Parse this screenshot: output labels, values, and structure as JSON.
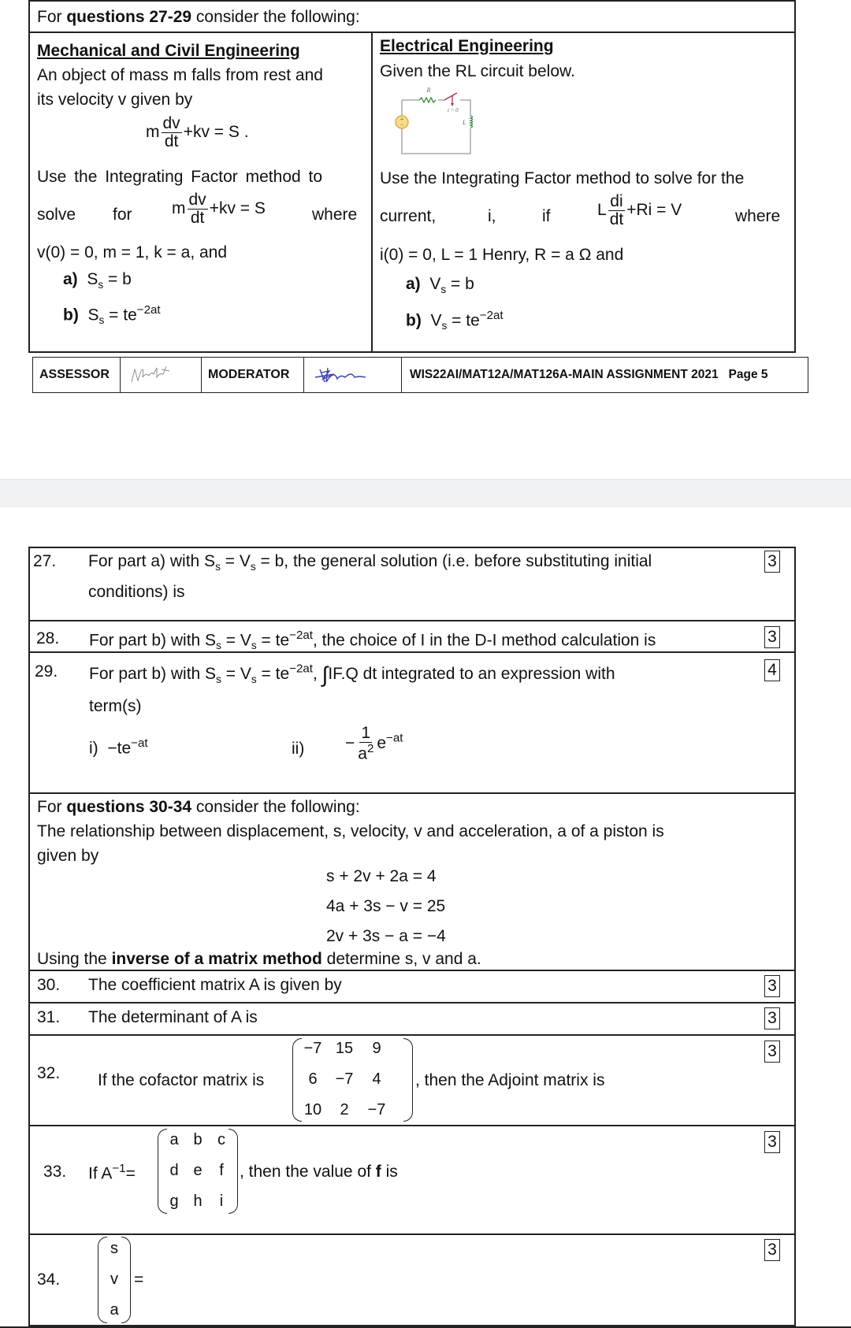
{
  "page1": {
    "intro": {
      "prefix": "For ",
      "bold": "questions 27-29",
      "suffix": " consider the following:"
    },
    "mech": {
      "heading": "Mechanical and Civil Engineering",
      "line1": "An object of mass m falls from rest and",
      "line2": "its velocity v given by",
      "eq_m": "m",
      "eq_num": "dv",
      "eq_den": "dt",
      "eq_rest": "+kv = S .",
      "use_line": "Use the Integrating Factor method to",
      "solve_word": "solve",
      "for_word": "for",
      "eq2_rest": "+kv = S",
      "where_word": "where",
      "conds": "v(0) = 0, m = 1, k = a,  and",
      "a_label": "a)",
      "a_S": "S",
      "a_sub": "s",
      "a_rest": " = b",
      "b_label": "b)",
      "b_S": "S",
      "b_sub": "s",
      "b_rest": " = te",
      "b_sup": "−2at"
    },
    "elec": {
      "heading": "Electrical Engineering",
      "line1": "Given the RL circuit below.",
      "circuit": {
        "R": "R",
        "L": "L",
        "Vs": "V",
        "Vs_sub": "s",
        "switch": "t = 0"
      },
      "use_line": "Use the Integrating Factor method to solve for the",
      "current_word": "current,",
      "i_word": "i,",
      "if_word": "if",
      "eq_L": "L",
      "eq_num": "di",
      "eq_den": "dt",
      "eq_rest": "+Ri = V",
      "where_word": "where",
      "conds": "i(0) = 0, L = 1 Henry,  R = a Ω   and",
      "a_label": "a)",
      "a_V": "V",
      "a_sub": "s",
      "a_rest": " = b",
      "b_label": "b)",
      "b_V": "V",
      "b_sub": "s",
      "b_rest": " = te",
      "b_sup": "−2at"
    },
    "footer": {
      "assessor": "ASSESSOR",
      "moderator": "MODERATOR",
      "code": "WIS22AI/MAT12A/MAT126A-MAIN ASSIGNMENT 2021",
      "page": "Page 5"
    }
  },
  "page2": {
    "q27": {
      "num": "27.",
      "t1": "For part a) with S",
      "s1": "s",
      "t2": " = V",
      "s2": "s",
      "t3": " = b, the general solution (i.e. before substituting initial",
      "t4": "conditions) is",
      "marks": "3"
    },
    "q28": {
      "num": "28.",
      "t1": "For part b) with S",
      "s1": "s",
      "t2": " = V",
      "s2": "s",
      "t3": " = te",
      "sup": "−2at",
      "t4": ", the choice of I in the D-I method calculation is",
      "marks": "3"
    },
    "q29": {
      "num": "29.",
      "t1": "For  part  b)  with  S",
      "s1": "s",
      "t2": " = V",
      "s2": "s",
      "t3": " = te",
      "sup": "−2at",
      "t4": ",",
      "integral": "∫",
      "t5": "IF.Q dt  integrated  to  an  expression  with",
      "t6": "term(s)",
      "opt_i_label": "i)",
      "opt_i_expr": "−te",
      "opt_i_sup": "−at",
      "opt_ii_label": "ii)",
      "opt_ii_minus": "−",
      "opt_ii_num": "1",
      "opt_ii_den": "a",
      "opt_ii_den_sup": "2",
      "opt_ii_e": "e",
      "opt_ii_sup": "−at",
      "marks": "4"
    },
    "intro2": {
      "prefix": "For ",
      "bold": "questions 30-34",
      "suffix": " consider the following:",
      "line1": "The relationship between displacement, s, velocity, v and acceleration, a of a piston is",
      "line2": "given by",
      "eq1": "s + 2v + 2a = 4",
      "eq2": "4a + 3s − v = 25",
      "eq3": "2v + 3s − a = −4",
      "using_prefix": "Using the ",
      "using_bold": "inverse of a matrix method",
      "using_suffix": " determine s, v and a."
    },
    "q30": {
      "num": "30.",
      "text": "The coefficient matrix A is given by",
      "marks": "3"
    },
    "q31": {
      "num": "31.",
      "text": "The determinant of A is",
      "marks": "3"
    },
    "q32": {
      "num": "32.",
      "pre": "If the cofactor matrix is",
      "post": ", then the Adjoint matrix is",
      "matrix": [
        [
          "−7",
          "15",
          "9"
        ],
        [
          "6",
          "−7",
          "4"
        ],
        [
          "10",
          "2",
          "−7"
        ]
      ],
      "marks": "3"
    },
    "q33": {
      "num": "33.",
      "pre": "If A",
      "sup": "−1",
      "eq": "=",
      "post_a": ", then the value of ",
      "post_b": "f",
      "post_c": " is",
      "matrix": [
        [
          "a",
          "b",
          "c"
        ],
        [
          "d",
          "e",
          "f"
        ],
        [
          "g",
          "h",
          "i"
        ]
      ],
      "marks": "3"
    },
    "q34": {
      "num": "34.",
      "vector": [
        "s",
        "v",
        "a"
      ],
      "eq": "=",
      "marks": "3"
    }
  }
}
